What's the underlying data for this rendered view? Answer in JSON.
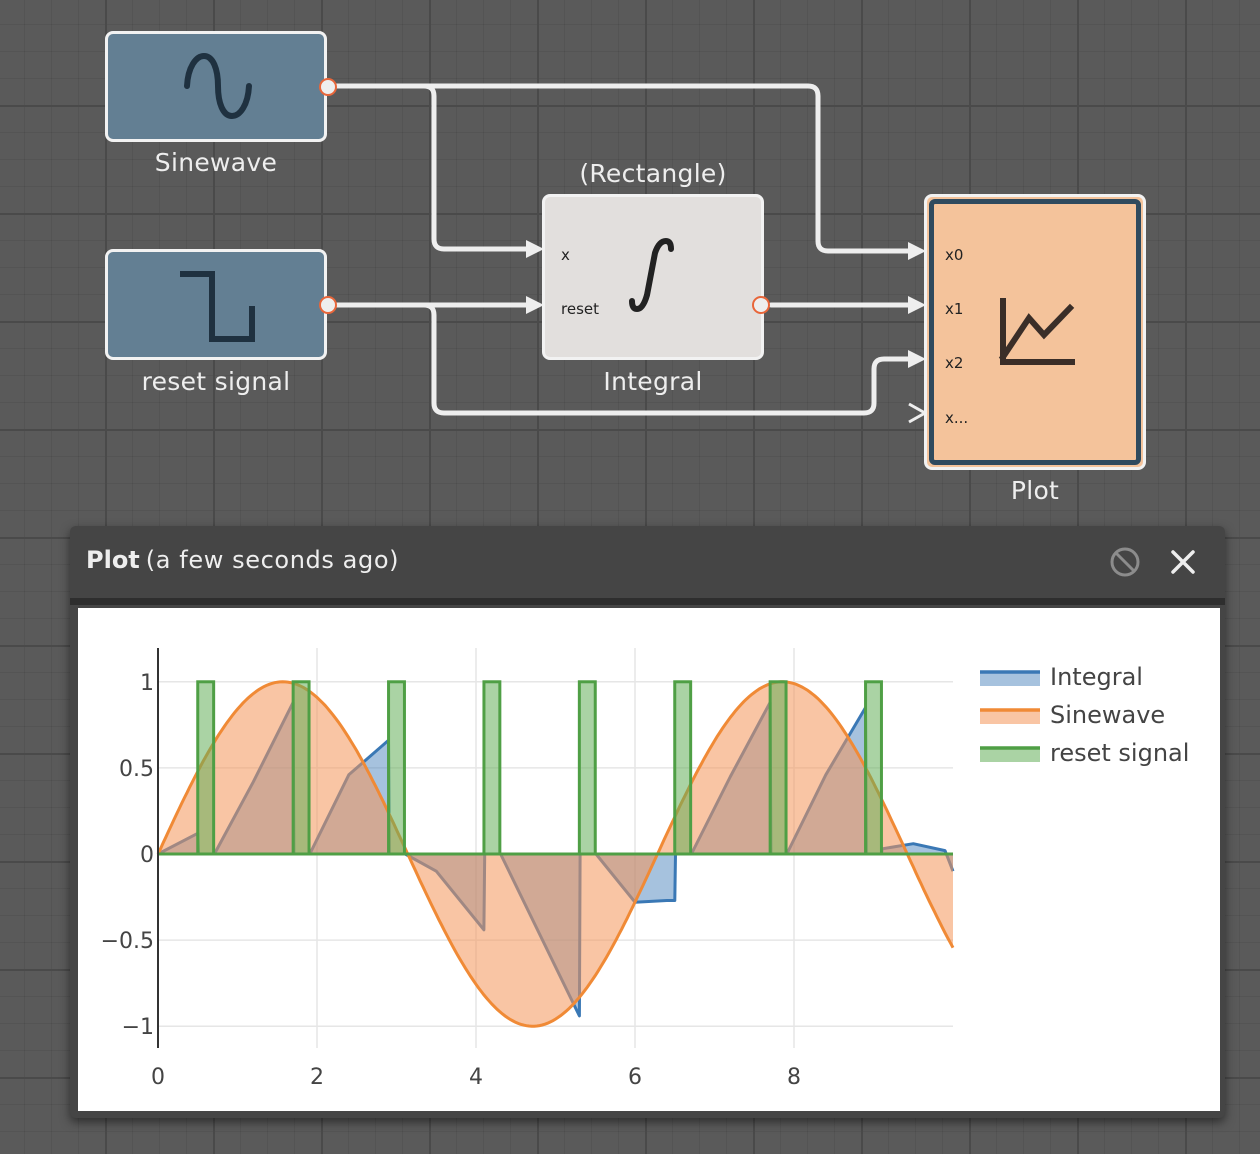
{
  "diagram": {
    "blocks": {
      "sinewave": {
        "label": "Sinewave"
      },
      "reset": {
        "label": "reset signal"
      },
      "integral": {
        "label": "Integral",
        "caption": "(Rectangle)",
        "ports_in": [
          "x",
          "reset"
        ]
      },
      "plot": {
        "label": "Plot",
        "ports_in": [
          "x0",
          "x1",
          "x2",
          "x..."
        ]
      }
    },
    "colors": {
      "source_block": "#637f93",
      "integral_block": "#e2dfdd",
      "plot_block": "#f4c39b",
      "plot_block_border": "#2f4a5e",
      "port_outline": "#e8663a",
      "wire": "#eeeeee"
    }
  },
  "plot_window": {
    "title": "Plot",
    "subtitle": "(a few seconds ago)",
    "disable_icon": "prohibit-icon",
    "close_icon": "close-icon"
  },
  "chart_data": {
    "type": "area",
    "xlim": [
      0,
      10
    ],
    "ylim": [
      -1.08,
      1.08
    ],
    "xticks": [
      0,
      2,
      4,
      6,
      8
    ],
    "yticks": [
      {
        "value": 1,
        "label": "1"
      },
      {
        "value": 0.5,
        "label": "0.5"
      },
      {
        "value": 0,
        "label": "0"
      },
      {
        "value": -0.5,
        "label": "−0.5"
      },
      {
        "value": -1,
        "label": "−1"
      }
    ],
    "grid": true,
    "legend_position": "top-right",
    "series": [
      {
        "name": "Integral",
        "color": "#3a78b5",
        "fill": "rgba(58,120,181,0.45)",
        "x": [
          0,
          0.5,
          0.51,
          0.7,
          0.71,
          1.2,
          1.7,
          1.71,
          1.9,
          1.91,
          2.4,
          2.9,
          2.91,
          3.1,
          3.11,
          3.5,
          4.1,
          4.11,
          4.3,
          4.31,
          5.3,
          5.31,
          5.5,
          5.51,
          6.0,
          6.4,
          6.5,
          6.51,
          6.7,
          6.71,
          7.2,
          7.7,
          7.71,
          7.9,
          7.91,
          8.4,
          8.9,
          8.91,
          9.1,
          9.11,
          9.5,
          9.9,
          10
        ],
        "y": [
          0,
          0.12,
          0,
          0,
          0,
          0.42,
          0.88,
          0,
          0,
          0,
          0.46,
          0.66,
          0,
          0,
          0,
          -0.1,
          -0.44,
          0,
          0,
          0,
          -0.94,
          0,
          0,
          0,
          -0.28,
          -0.27,
          -0.27,
          0,
          0,
          0,
          0.45,
          0.88,
          0,
          0,
          0,
          0.46,
          0.85,
          0,
          0,
          0.03,
          0.06,
          0.02,
          -0.1
        ]
      },
      {
        "name": "Sinewave",
        "color": "#f08a36",
        "fill": "rgba(244,150,90,0.55)",
        "function": "sin",
        "x_range": [
          0,
          10
        ]
      },
      {
        "name": "reset signal",
        "color": "#4f9f45",
        "fill": "rgba(100,175,90,0.55)",
        "pulses": [
          [
            0.5,
            0.7
          ],
          [
            1.7,
            1.9
          ],
          [
            2.9,
            3.1
          ],
          [
            4.1,
            4.3
          ],
          [
            5.3,
            5.5
          ],
          [
            6.5,
            6.7
          ],
          [
            7.7,
            7.9
          ],
          [
            8.9,
            9.1
          ]
        ],
        "pulse_height": 1
      }
    ]
  }
}
